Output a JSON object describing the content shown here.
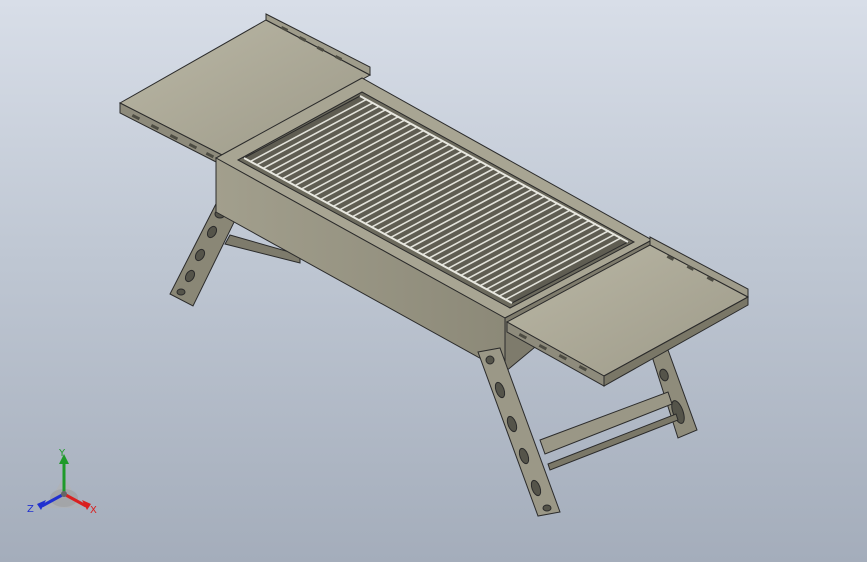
{
  "colors": {
    "background_top": "#d8dee8",
    "background_bottom": "#a4adbb",
    "steel_light": "#b4b19e",
    "steel_mid": "#8e8b7c",
    "steel_dark": "#676557",
    "edge": "#2b2b2b",
    "grill_wire": "#dcdcd4",
    "axis_x": "#d92020",
    "axis_y": "#1f9a2a",
    "axis_z": "#2030d0"
  },
  "triad": {
    "x_label": "X",
    "y_label": "Y",
    "z_label": "Z"
  }
}
